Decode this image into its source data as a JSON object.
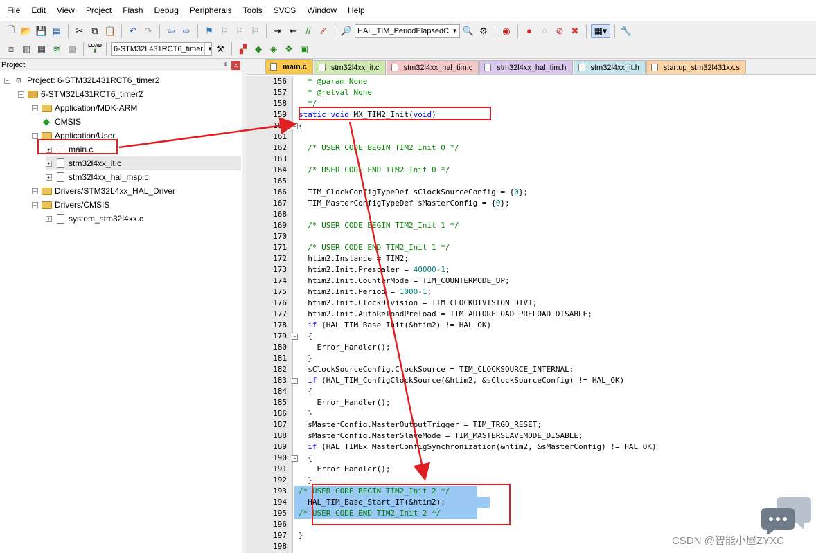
{
  "menu": [
    "File",
    "Edit",
    "View",
    "Project",
    "Flash",
    "Debug",
    "Peripherals",
    "Tools",
    "SVCS",
    "Window",
    "Help"
  ],
  "toolbar1": {
    "function_combo": "HAL_TIM_PeriodElapsedC"
  },
  "toolbar2": {
    "target_combo": "6-STM32L431RCT6_timer.",
    "load_label": "LOAD"
  },
  "project_panel": {
    "title": "Project",
    "pin": "ᵖ",
    "close": "x",
    "tree": [
      {
        "label": "Project: 6-STM32L431RCT6_timer2"
      },
      {
        "label": "6-STM32L431RCT6_timer2"
      },
      {
        "label": "Application/MDK-ARM"
      },
      {
        "label": "CMSIS"
      },
      {
        "label": "Application/User"
      },
      {
        "label": "main.c"
      },
      {
        "label": "stm32l4xx_it.c"
      },
      {
        "label": "stm32l4xx_hal_msp.c"
      },
      {
        "label": "Drivers/STM32L4xx_HAL_Driver"
      },
      {
        "label": "Drivers/CMSIS"
      },
      {
        "label": "system_stm32l4xx.c"
      }
    ]
  },
  "tabs": [
    {
      "label": "main.c",
      "color": "#f9c84a"
    },
    {
      "label": "stm32l4xx_it.c",
      "color": "#cfe8b0"
    },
    {
      "label": "stm32l4xx_hal_tim.c",
      "color": "#f5c6c8"
    },
    {
      "label": "stm32l4xx_hal_tim.h",
      "color": "#d9c6ec"
    },
    {
      "label": "stm32l4xx_it.h",
      "color": "#c6e4ec"
    },
    {
      "label": "startup_stm32l431xx.s",
      "color": "#fbd3a4"
    }
  ],
  "code_lines": [
    {
      "num": "156",
      "text": "  * @param None"
    },
    {
      "num": "157",
      "text": "  * @retval None"
    },
    {
      "num": "158",
      "text": "  */"
    },
    {
      "num": "159",
      "text": "static void MX_TIM2_Init(void)"
    },
    {
      "num": "160",
      "text": "{"
    },
    {
      "num": "161",
      "text": ""
    },
    {
      "num": "162",
      "text": "  /* USER CODE BEGIN TIM2_Init 0 */"
    },
    {
      "num": "163",
      "text": ""
    },
    {
      "num": "164",
      "text": "  /* USER CODE END TIM2_Init 0 */"
    },
    {
      "num": "165",
      "text": ""
    },
    {
      "num": "166",
      "text": "  TIM_ClockConfigTypeDef sClockSourceConfig = {0};"
    },
    {
      "num": "167",
      "text": "  TIM_MasterConfigTypeDef sMasterConfig = {0};"
    },
    {
      "num": "168",
      "text": ""
    },
    {
      "num": "169",
      "text": "  /* USER CODE BEGIN TIM2_Init 1 */"
    },
    {
      "num": "170",
      "text": ""
    },
    {
      "num": "171",
      "text": "  /* USER CODE END TIM2_Init 1 */"
    },
    {
      "num": "172",
      "text": "  htim2.Instance = TIM2;"
    },
    {
      "num": "173",
      "text": "  htim2.Init.Prescaler = 40000-1;"
    },
    {
      "num": "174",
      "text": "  htim2.Init.CounterMode = TIM_COUNTERMODE_UP;"
    },
    {
      "num": "175",
      "text": "  htim2.Init.Period = 1000-1;"
    },
    {
      "num": "176",
      "text": "  htim2.Init.ClockDivision = TIM_CLOCKDIVISION_DIV1;"
    },
    {
      "num": "177",
      "text": "  htim2.Init.AutoReloadPreload = TIM_AUTORELOAD_PRELOAD_DISABLE;"
    },
    {
      "num": "178",
      "text": "  if (HAL_TIM_Base_Init(&htim2) != HAL_OK)"
    },
    {
      "num": "179",
      "text": "  {"
    },
    {
      "num": "180",
      "text": "    Error_Handler();"
    },
    {
      "num": "181",
      "text": "  }"
    },
    {
      "num": "182",
      "text": "  sClockSourceConfig.ClockSource = TIM_CLOCKSOURCE_INTERNAL;"
    },
    {
      "num": "183",
      "text": "  if (HAL_TIM_ConfigClockSource(&htim2, &sClockSourceConfig) != HAL_OK)"
    },
    {
      "num": "184",
      "text": "  {"
    },
    {
      "num": "185",
      "text": "    Error_Handler();"
    },
    {
      "num": "186",
      "text": "  }"
    },
    {
      "num": "187",
      "text": "  sMasterConfig.MasterOutputTrigger = TIM_TRGO_RESET;"
    },
    {
      "num": "188",
      "text": "  sMasterConfig.MasterSlaveMode = TIM_MASTERSLAVEMODE_DISABLE;"
    },
    {
      "num": "189",
      "text": "  if (HAL_TIMEx_MasterConfigSynchronization(&htim2, &sMasterConfig) != HAL_OK)"
    },
    {
      "num": "190",
      "text": "  {"
    },
    {
      "num": "191",
      "text": "    Error_Handler();"
    },
    {
      "num": "192",
      "text": "  }"
    },
    {
      "num": "193",
      "text": "/* USER CODE BEGIN TIM2_Init 2 */"
    },
    {
      "num": "194",
      "text": "  HAL_TIM_Base_Start_IT(&htim2);"
    },
    {
      "num": "195",
      "text": "/* USER CODE END TIM2_Init 2 */"
    },
    {
      "num": "196",
      "text": ""
    },
    {
      "num": "197",
      "text": "}"
    },
    {
      "num": "198",
      "text": ""
    }
  ],
  "watermark": "CSDN @智能小屋ZYXC",
  "colors": {
    "highlight": "#99c9f4",
    "annotation": "#e02020",
    "comment": "#008000",
    "keyword": "#0000ff",
    "number": "#008080"
  }
}
